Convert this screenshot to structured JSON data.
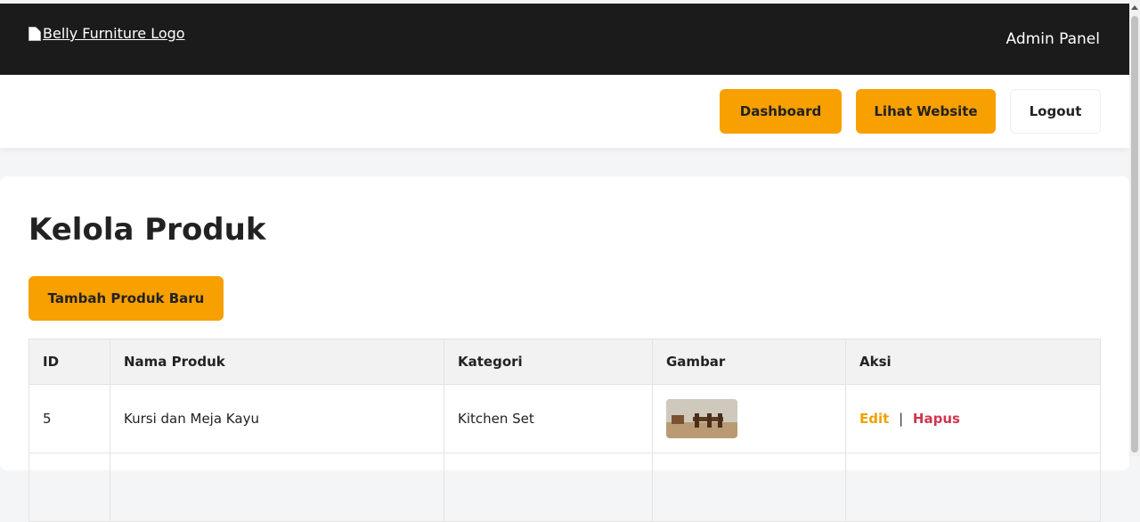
{
  "header": {
    "logo_alt": "Belly Furniture Logo",
    "admin_label": "Admin Panel"
  },
  "nav": {
    "dashboard": "Dashboard",
    "view_site": "Lihat Website",
    "logout": "Logout"
  },
  "main": {
    "title": "Kelola Produk",
    "add_button": "Tambah Produk Baru",
    "table": {
      "columns": [
        "ID",
        "Nama Produk",
        "Kategori",
        "Gambar",
        "Aksi"
      ],
      "rows": [
        {
          "id": "5",
          "name": "Kursi dan Meja Kayu",
          "category": "Kitchen Set",
          "image": "product-thumbnail",
          "edit": "Edit",
          "separator": "|",
          "delete": "Hapus"
        }
      ]
    }
  },
  "colors": {
    "accent": "#f7a000",
    "header_bg": "#1b1b1b",
    "delete": "#d0354b"
  }
}
